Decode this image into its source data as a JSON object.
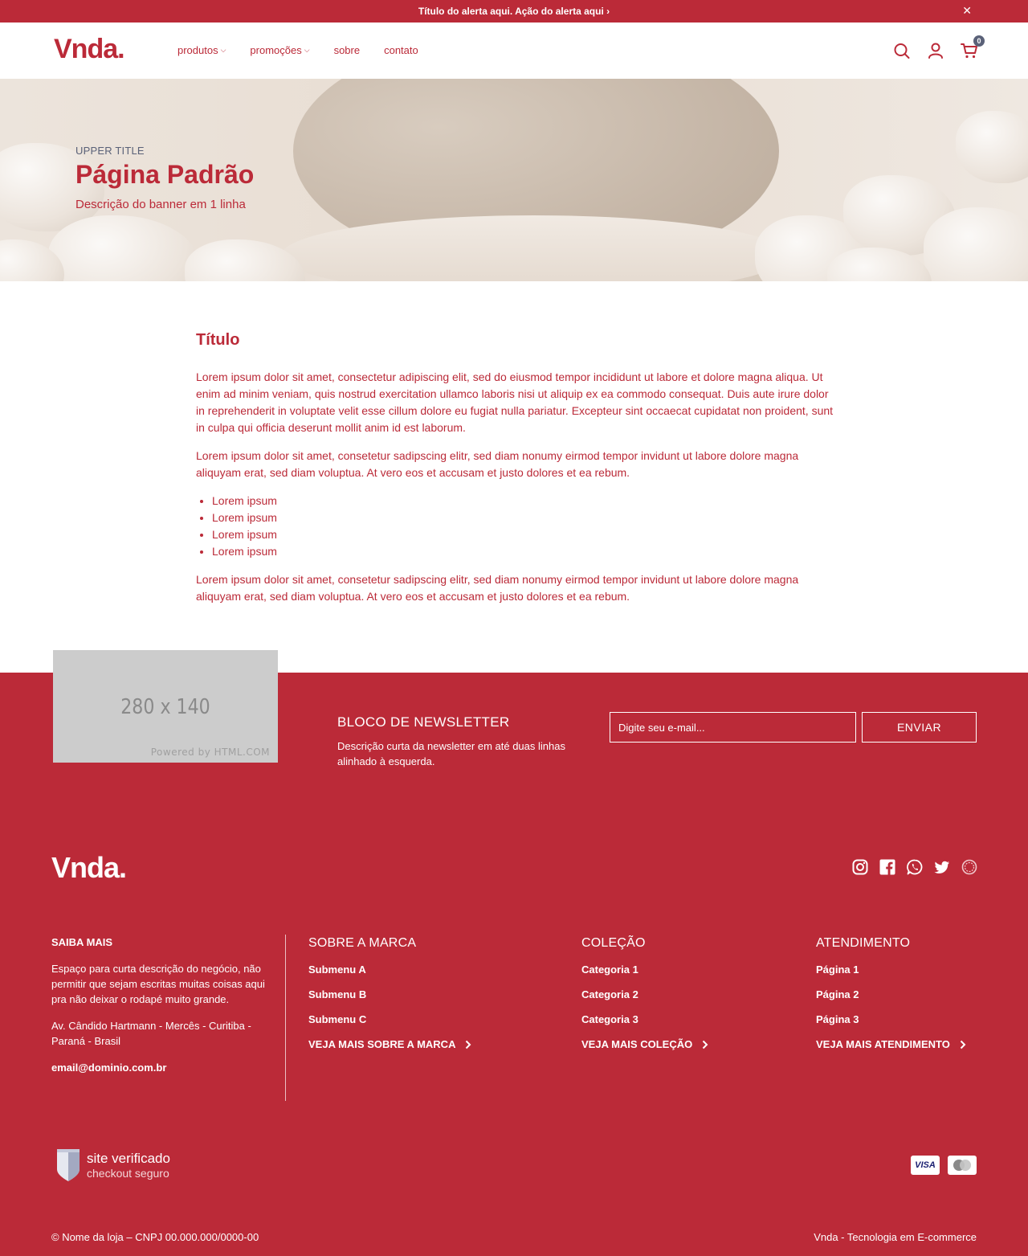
{
  "alert": {
    "text": "Título do alerta aqui. Ação do alerta aqui",
    "arrow": "›",
    "close_label": "✕"
  },
  "header": {
    "logo": "Vnda.",
    "nav": [
      {
        "label": "produtos",
        "has_dropdown": true
      },
      {
        "label": "promoções",
        "has_dropdown": true
      },
      {
        "label": "sobre",
        "has_dropdown": false
      },
      {
        "label": "contato",
        "has_dropdown": false
      }
    ],
    "cart_count": "0",
    "icons": [
      "search-icon",
      "user-icon",
      "cart-icon"
    ]
  },
  "banner": {
    "upper_title": "UPPER TITLE",
    "title": "Página Padrão",
    "description": "Descrição do banner em 1 linha"
  },
  "content": {
    "title": "Título",
    "paragraph_1": "Lorem ipsum dolor sit amet, consectetur adipiscing elit, sed do eiusmod tempor incididunt ut labore et dolore magna aliqua. Ut enim ad minim veniam, quis nostrud exercitation ullamco laboris nisi ut aliquip ex ea commodo consequat. Duis aute irure dolor in reprehenderit in voluptate velit esse cillum dolore eu fugiat nulla pariatur. Excepteur sint occaecat cupidatat non proident, sunt in culpa qui officia deserunt mollit anim id est laborum.",
    "paragraph_2": "Lorem ipsum dolor sit amet, consetetur sadipscing elitr, sed diam nonumy eirmod tempor invidunt ut labore dolore magna aliquyam erat, sed diam voluptua. At vero eos et accusam et justo dolores et ea rebum.",
    "list": [
      "Lorem ipsum",
      "Lorem ipsum",
      "Lorem ipsum",
      "Lorem ipsum"
    ],
    "paragraph_3": "Lorem ipsum dolor sit amet, consetetur sadipscing elitr, sed diam nonumy eirmod tempor invidunt ut labore dolore magna aliquyam erat, sed diam voluptua. At vero eos et accusam et justo dolores et ea rebum."
  },
  "placeholder_image": {
    "size_text": "280 x 140",
    "credit": "Powered by HTML.COM"
  },
  "newsletter": {
    "title": "BLOCO DE NEWSLETTER",
    "description": "Descrição curta da newsletter em até duas linhas alinhado à esquerda.",
    "input_placeholder": "Digite seu e-mail...",
    "button_label": "ENVIAR"
  },
  "footer": {
    "logo": "Vnda.",
    "social": [
      "instagram-icon",
      "facebook-icon",
      "whatsapp-icon",
      "twitter-icon",
      "dribbble-icon"
    ],
    "about": {
      "title": "SAIBA MAIS",
      "description": "Espaço para curta descrição do negócio, não permitir que sejam escritas muitas coisas aqui pra não deixar o rodapé muito grande.",
      "address": "Av. Cândido Hartmann - Mercês - Curitiba - Paraná - Brasil",
      "email": "email@dominio.com.br"
    },
    "menus": [
      {
        "title": "SOBRE A MARCA",
        "items": [
          "Submenu A",
          "Submenu B",
          "Submenu C"
        ],
        "more": "VEJA MAIS SOBRE A MARCA"
      },
      {
        "title": "COLEÇÃO",
        "items": [
          "Categoria 1",
          "Categoria 2",
          "Categoria 3"
        ],
        "more": "VEJA MAIS COLEÇÃO"
      },
      {
        "title": "ATENDIMENTO",
        "items": [
          "Página 1",
          "Página 2",
          "Página 3"
        ],
        "more": "VEJA MAIS ATENDIMENTO"
      }
    ],
    "verified": {
      "line1": "site verificado",
      "line2": "checkout seguro"
    },
    "payment_cards": [
      "VISA",
      "mastercard-icon"
    ],
    "copyright": "© Nome da loja – CNPJ 00.000.000/0000-00",
    "credit": "Vnda - Tecnologia em E-commerce"
  },
  "colors": {
    "brand": "#bb2a38",
    "secondary": "#5a6178",
    "background": "#ffffff"
  }
}
